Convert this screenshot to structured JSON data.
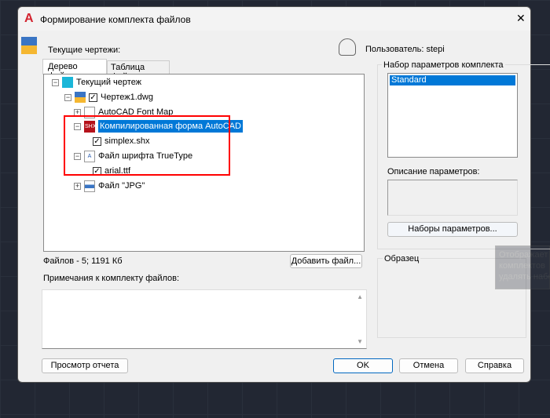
{
  "window": {
    "title": "Формирование комплекта файлов",
    "close": "✕"
  },
  "header": {
    "current_drawings": "Текущие чертежи:",
    "user": "Пользователь: stepi"
  },
  "tabs": [
    {
      "label": "Дерево файлов"
    },
    {
      "label": "Таблица файлов"
    }
  ],
  "tree": [
    {
      "label": "Текущий чертеж",
      "icon": "drawing-icon"
    },
    {
      "label": "Чертеж1.dwg",
      "checked": true
    },
    {
      "label": "AutoCAD Font Map"
    },
    {
      "label": "Компилированная форма AutoCAD",
      "selected": true,
      "icon_text": "SHX"
    },
    {
      "label": "simplex.shx",
      "checked": true
    },
    {
      "label": "Файл шрифта TrueType",
      "icon_text": "A"
    },
    {
      "label": "arial.ttf",
      "checked": true
    },
    {
      "label": "Файл \"JPG\""
    }
  ],
  "status": "Файлов - 5; 1191 Кб",
  "add_file": "Добавить файл...",
  "notes_label": "Примечания к комплекту файлов:",
  "notes_value": "",
  "param_set": {
    "title": "Набор параметров комплекта",
    "items": [
      "Standard"
    ],
    "desc_label": "Описание параметров:",
    "button": "Наборы параметров..."
  },
  "sample": {
    "title": "Образец"
  },
  "tooltip": [
    "Отображает",
    "комплектов",
    "удалять набо"
  ],
  "buttons": {
    "report": "Просмотр отчета",
    "ok": "OK",
    "cancel": "Отмена",
    "help": "Справка"
  },
  "colors": {
    "accent": "#0078d7",
    "highlight": "#ff0000"
  }
}
